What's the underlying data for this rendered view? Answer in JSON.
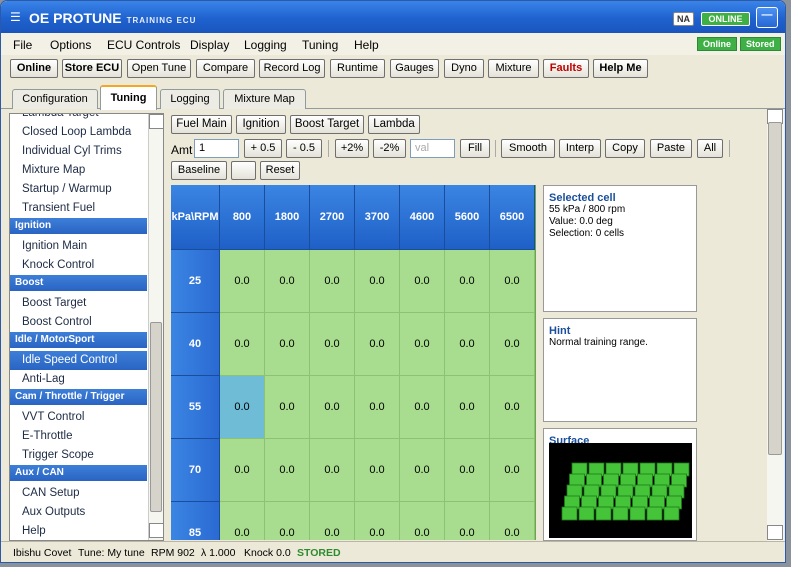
{
  "window": {
    "title": "OE PROTUNE",
    "subtitle": "TRAINING ECU",
    "badge_na": "NA",
    "badge_online": "ONLINE",
    "minimize_label": "—"
  },
  "menu": {
    "items": [
      "File",
      "Options",
      "ECU Controls",
      "Display",
      "Logging",
      "Tuning",
      "Help"
    ],
    "status_online": "Online",
    "status_stored": "Stored"
  },
  "toolbar": {
    "buttons": [
      "Online",
      "Store ECU",
      "Open Tune",
      "Compare",
      "Record Log",
      "Runtime",
      "Gauges",
      "Dyno",
      "Mixture",
      "Faults",
      "Help Me"
    ]
  },
  "tabs": {
    "items": [
      "Configuration",
      "Tuning",
      "Logging",
      "Mixture Map"
    ],
    "active": "Tuning"
  },
  "sidebar": {
    "items": [
      {
        "label": "Lambda Target",
        "type": "item"
      },
      {
        "label": "Closed Loop Lambda",
        "type": "item"
      },
      {
        "label": "Individual Cyl Trims",
        "type": "item"
      },
      {
        "label": "Mixture Map",
        "type": "item"
      },
      {
        "label": "Startup / Warmup",
        "type": "item"
      },
      {
        "label": "Transient Fuel",
        "type": "item"
      },
      {
        "label": "Ignition",
        "type": "header"
      },
      {
        "label": "Ignition Main",
        "type": "item"
      },
      {
        "label": "Knock Control",
        "type": "item"
      },
      {
        "label": "Boost",
        "type": "header"
      },
      {
        "label": "Boost Target",
        "type": "item"
      },
      {
        "label": "Boost Control",
        "type": "item"
      },
      {
        "label": "Idle / MotorSport",
        "type": "header"
      },
      {
        "label": "Idle Speed Control",
        "type": "selected"
      },
      {
        "label": "Anti-Lag",
        "type": "item"
      },
      {
        "label": "Cam / Throttle / Trigger",
        "type": "header"
      },
      {
        "label": "VVT Control",
        "type": "item"
      },
      {
        "label": "E-Throttle",
        "type": "item"
      },
      {
        "label": "Trigger Scope",
        "type": "item"
      },
      {
        "label": "Aux / CAN",
        "type": "header"
      },
      {
        "label": "CAN Setup",
        "type": "item"
      },
      {
        "label": "Aux Outputs",
        "type": "item"
      },
      {
        "label": "Help",
        "type": "item"
      }
    ]
  },
  "subtabs": {
    "items": [
      "Fuel Main",
      "Ignition",
      "Boost Target",
      "Lambda"
    ]
  },
  "controls": {
    "amt_label": "Amt",
    "amt_value": "1",
    "plus_half": "+ 0.5",
    "minus_half": "- 0.5",
    "plus_pct": "+2%",
    "minus_pct": "-2%",
    "val_placeholder": "val",
    "fill": "Fill",
    "smooth": "Smooth",
    "interp": "Interp",
    "copy": "Copy",
    "paste": "Paste",
    "all": "All",
    "baseline": "Baseline",
    "blank": "",
    "reset": "Reset"
  },
  "table": {
    "corner": "kPa\\RPM",
    "rpm": [
      "800",
      "1800",
      "2700",
      "3700",
      "4600",
      "5600",
      "6500"
    ],
    "kpa": [
      "25",
      "40",
      "55",
      "70",
      "85"
    ],
    "values": [
      [
        "0.0",
        "0.0",
        "0.0",
        "0.0",
        "0.0",
        "0.0",
        "0.0"
      ],
      [
        "0.0",
        "0.0",
        "0.0",
        "0.0",
        "0.0",
        "0.0",
        "0.0"
      ],
      [
        "0.0",
        "0.0",
        "0.0",
        "0.0",
        "0.0",
        "0.0",
        "0.0"
      ],
      [
        "0.0",
        "0.0",
        "0.0",
        "0.0",
        "0.0",
        "0.0",
        "0.0"
      ],
      [
        "0.0",
        "0.0",
        "0.0",
        "0.0",
        "0.0",
        "0.0",
        "0.0"
      ]
    ],
    "selected_row": 2,
    "selected_col": 0
  },
  "info": {
    "selected_title": "Selected cell",
    "selected_lines": [
      "55 kPa / 800 rpm",
      "Value: 0.0 deg",
      "Selection: 0 cells"
    ],
    "hint_title": "Hint",
    "hint_text": "Normal training range.",
    "surface_title": "Surface"
  },
  "statusbar": {
    "user": "Ibishu Covet",
    "tune": "Tune: My tune",
    "rpm": "RPM 902",
    "lambda": "λ 1.000",
    "knock": "Knock 0.0",
    "stored": "STORED"
  },
  "colors": {
    "accent": "#2a64c3",
    "cell": "#a8dc8e",
    "selected_cell": "#6ebcd6",
    "online": "#3fb046",
    "faults": "#c00000",
    "stored": "#2e8b2e"
  }
}
